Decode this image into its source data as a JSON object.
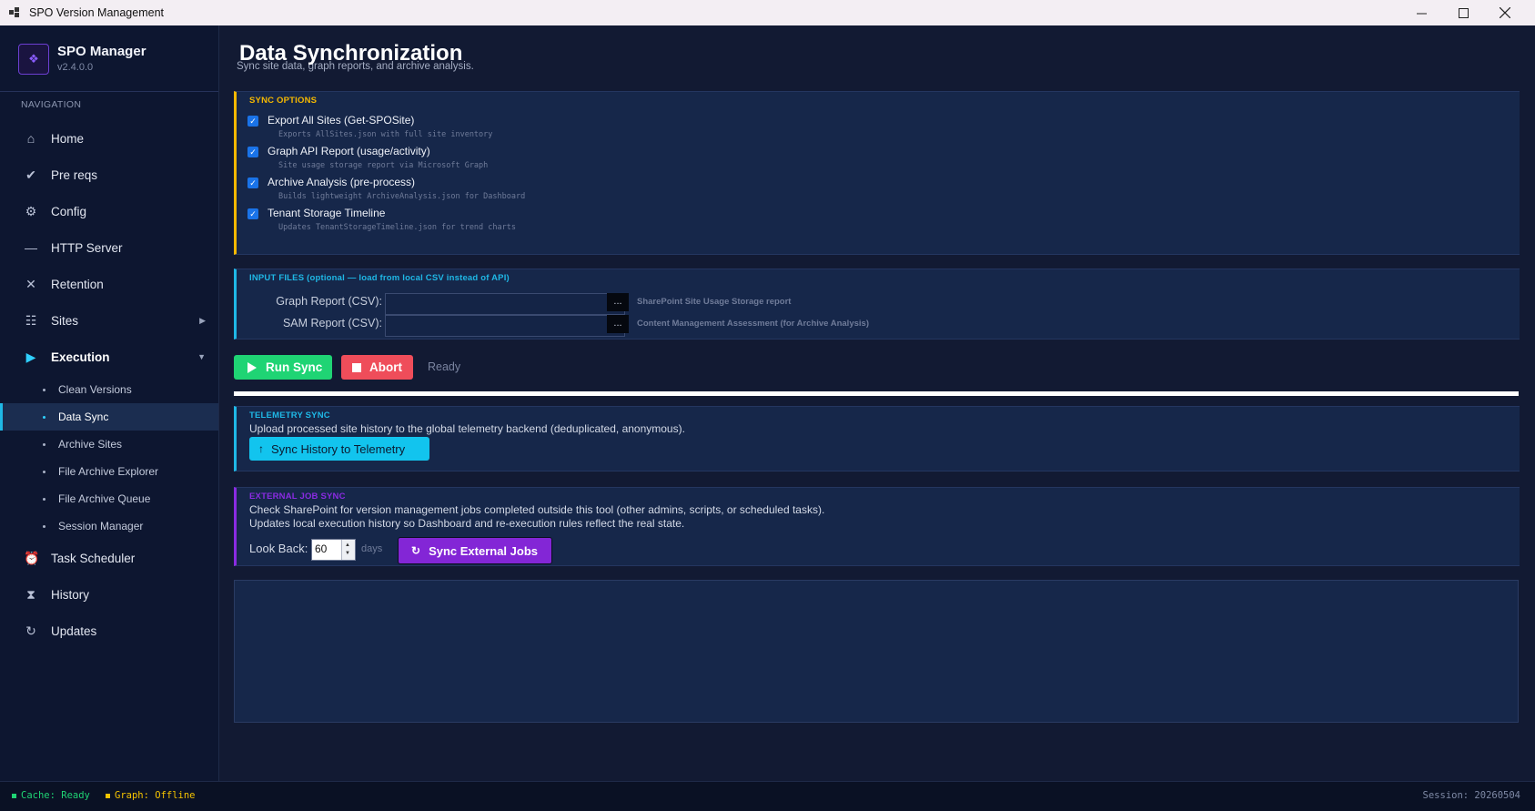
{
  "window": {
    "title": "SPO Version Management"
  },
  "app": {
    "name": "SPO Manager",
    "version": "v2.4.0.0"
  },
  "nav": {
    "heading": "NAVIGATION",
    "items": [
      {
        "label": "Home",
        "icon": "home-icon"
      },
      {
        "label": "Pre reqs",
        "icon": "checkmark-icon"
      },
      {
        "label": "Config",
        "icon": "gear-icon"
      },
      {
        "label": "HTTP Server",
        "icon": "dash-icon"
      },
      {
        "label": "Retention",
        "icon": "close-icon"
      },
      {
        "label": "Sites",
        "icon": "list-icon"
      },
      {
        "label": "Execution",
        "icon": "play-icon"
      },
      {
        "label": "Task Scheduler",
        "icon": "alarm-clock-icon"
      },
      {
        "label": "History",
        "icon": "hourglass-icon"
      },
      {
        "label": "Updates",
        "icon": "refresh-icon"
      }
    ],
    "execution_sub": [
      {
        "label": "Clean Versions"
      },
      {
        "label": "Data Sync"
      },
      {
        "label": "Archive Sites"
      },
      {
        "label": "File Archive Explorer"
      },
      {
        "label": "File Archive Queue"
      },
      {
        "label": "Session Manager"
      }
    ],
    "active_sub": "Data Sync"
  },
  "page": {
    "title": "Data Synchronization",
    "subtitle": "Sync site data, graph reports, and archive analysis."
  },
  "sync_options": {
    "title": "SYNC OPTIONS",
    "accent": "#f5b800",
    "options": [
      {
        "label": "Export All Sites (Get-SPOSite)",
        "desc": "Exports AllSites.json with full site inventory",
        "checked": true
      },
      {
        "label": "Graph API Report (usage/activity)",
        "desc": "Site usage storage report via Microsoft Graph",
        "checked": true
      },
      {
        "label": "Archive Analysis (pre-process)",
        "desc": "Builds lightweight ArchiveAnalysis.json for Dashboard",
        "checked": true
      },
      {
        "label": "Tenant Storage Timeline",
        "desc": "Updates TenantStorageTimeline.json for trend charts",
        "checked": true
      }
    ]
  },
  "input_files": {
    "title": "INPUT FILES (optional — load from local CSV instead of API)",
    "accent": "#1fb8e6",
    "rows": [
      {
        "label": "Graph Report (CSV):",
        "value": "",
        "browse": "...",
        "hint": "SharePoint Site Usage Storage report"
      },
      {
        "label": "SAM Report (CSV):",
        "value": "",
        "browse": "...",
        "hint": "Content Management Assessment (for Archive Analysis)"
      }
    ]
  },
  "actions": {
    "run_label": "Run Sync",
    "abort_label": "Abort",
    "status": "Ready",
    "progress": 1.0
  },
  "telemetry": {
    "title": "TELEMETRY SYNC",
    "accent": "#1fb8e6",
    "description": "Upload processed site history to the global telemetry backend (deduplicated, anonymous).",
    "button_label": "Sync History to Telemetry",
    "button_icon": "↑"
  },
  "external": {
    "title": "EXTERNAL JOB SYNC",
    "accent": "#8a2be2",
    "description_1": "Check SharePoint for version management jobs completed outside this tool (other admins, scripts, or scheduled tasks).",
    "description_2": "Updates local execution history so Dashboard and re-execution rules reflect the real state.",
    "lookback_label": "Look Back:",
    "lookback_value": "60",
    "lookback_unit": "days",
    "button_label": "Sync External Jobs",
    "button_icon": "↻"
  },
  "log": {
    "content": ""
  },
  "statusbar": {
    "cache": "Cache: Ready",
    "cache_color": "#1fd474",
    "graph": "Graph: Offline",
    "graph_color": "#f5c400",
    "session": "Session: 20260504"
  }
}
